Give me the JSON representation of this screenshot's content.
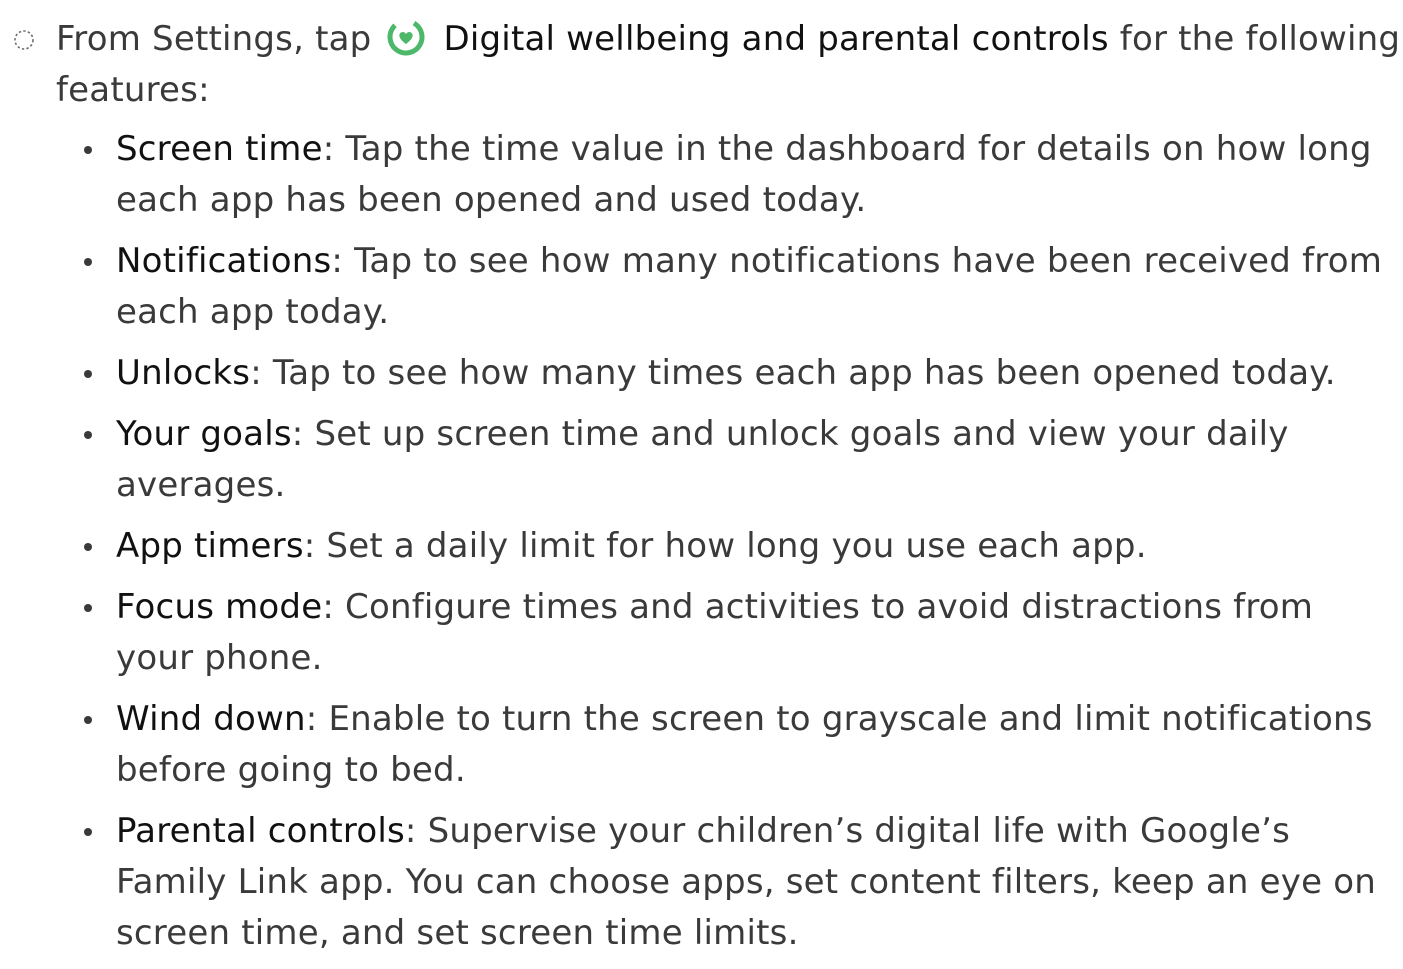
{
  "intro": {
    "prefix": "From Settings, tap",
    "app_name": "Digital wellbeing and parental controls",
    "suffix": "for the following features:",
    "icon": "digital-wellbeing-icon",
    "icon_colors": {
      "ring": "#4db86a",
      "heart": "#4db86a",
      "inner": "#ffffff"
    }
  },
  "features": [
    {
      "name": "Screen time",
      "description": ": Tap the time value in the dashboard for details on how long each app has been opened and used today."
    },
    {
      "name": "Notifications",
      "description": ": Tap to see how many notifications have been received from each app today."
    },
    {
      "name": "Unlocks",
      "description": ": Tap to see how many times each app has been opened today."
    },
    {
      "name": "Your goals",
      "description": ": Set up screen time and unlock goals and view your daily averages."
    },
    {
      "name": "App timers",
      "description": ": Set a daily limit for how long you use each app."
    },
    {
      "name": "Focus mode",
      "description": ": Configure times and activities to avoid distractions from your phone."
    },
    {
      "name": "Wind down",
      "description": ": Enable to turn the screen to grayscale and limit notifications before going to bed."
    },
    {
      "name": "Parental controls",
      "description": ": Supervise your children’s digital life with Google’s Family Link app. You can choose apps, set content filters, keep an eye on screen time, and set screen time limits."
    }
  ]
}
